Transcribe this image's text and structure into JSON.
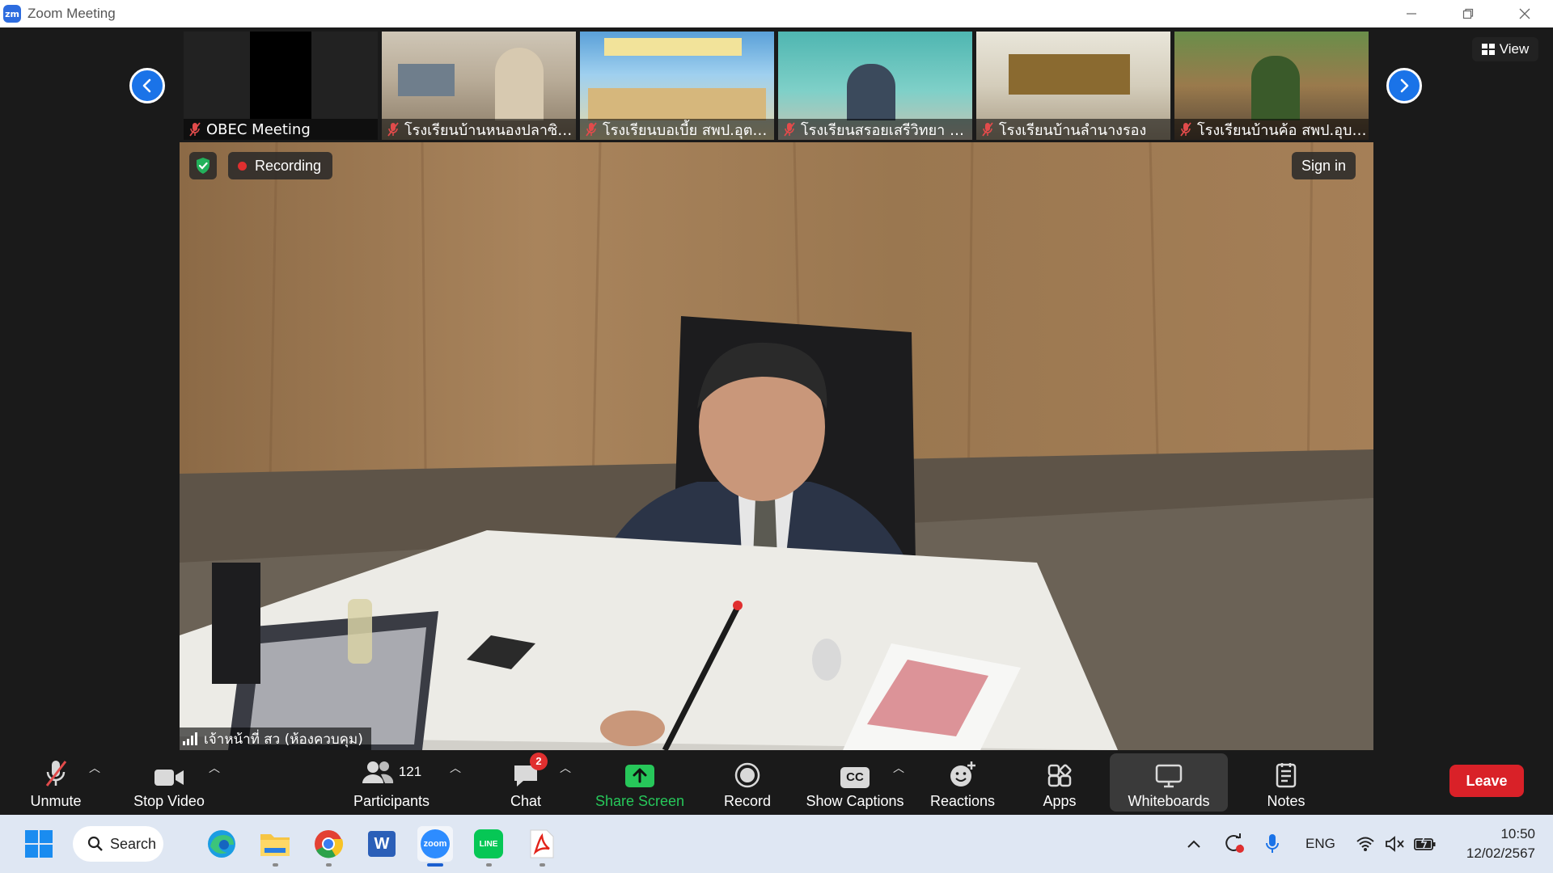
{
  "window": {
    "app_logo": "zm",
    "title": "Zoom Meeting"
  },
  "strip": {
    "thumbnails": [
      {
        "name": "OBEC Meeting"
      },
      {
        "name": "โรงเรียนบ้านหนองปลาซิว ..."
      },
      {
        "name": "โรงเรียนบอเบี้ย สพป.อุตรดิ..."
      },
      {
        "name": "โรงเรียนสรอยเสรีวิทยา สพ..."
      },
      {
        "name": "โรงเรียนบ้านลำนางรอง"
      },
      {
        "name": "โรงเรียนบ้านค้อ สพป.อุบลร..."
      }
    ],
    "view_label": "View"
  },
  "main": {
    "recording_label": "Recording",
    "signin_label": "Sign in",
    "speaker_name": "เจ้าหน้าที่ สว (ห้องควบคุม)"
  },
  "toolbar": {
    "unmute": "Unmute",
    "stop_video": "Stop Video",
    "participants": "Participants",
    "participants_count": "121",
    "chat": "Chat",
    "chat_badge": "2",
    "share_screen": "Share Screen",
    "record": "Record",
    "show_captions": "Show Captions",
    "captions_icon_text": "CC",
    "reactions": "Reactions",
    "apps": "Apps",
    "whiteboards": "Whiteboards",
    "notes": "Notes",
    "leave": "Leave"
  },
  "taskbar": {
    "search": "Search",
    "zoom_icon_text": "zoom",
    "line_icon_text": "LINE",
    "word_icon_text": "W",
    "language": "ENG",
    "time": "10:50",
    "date": "12/02/2567"
  },
  "colors": {
    "accent": "#1a73e8",
    "share_green": "#27c75a",
    "leave_red": "#d92128",
    "record_red": "#e02f2f"
  }
}
